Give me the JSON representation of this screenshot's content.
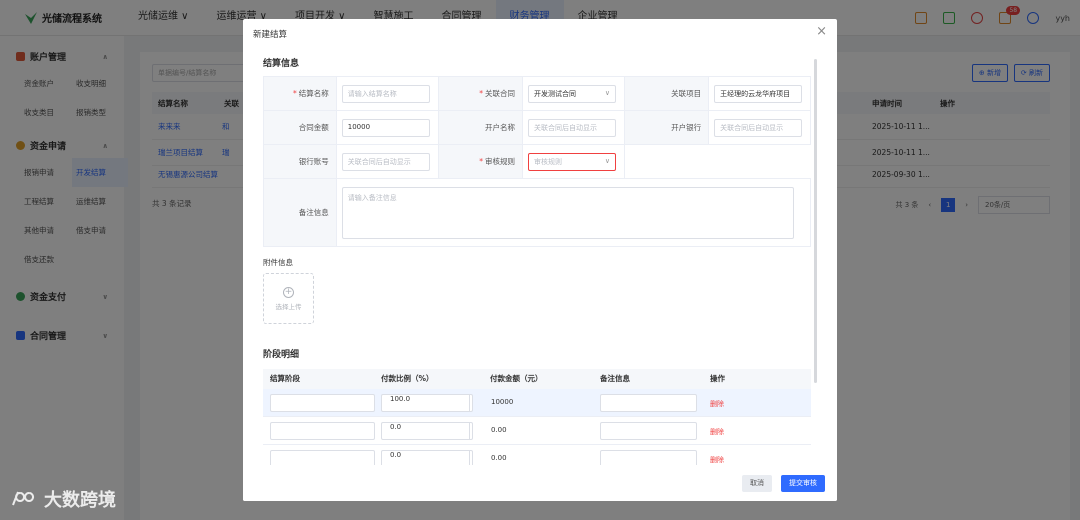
{
  "app": {
    "name": "光储流程系统",
    "user": "yyh",
    "notification_count": "58"
  },
  "nav": [
    "光储运维 ∨",
    "运维运营 ∨",
    "项目开发 ∨",
    "智慧施工",
    "合同管理",
    "财务管理",
    "企业管理"
  ],
  "sidebar": {
    "groups": [
      {
        "label": "账户管理",
        "items": [
          "资金账户",
          "收支明细",
          "收支类目",
          "报销类型"
        ]
      },
      {
        "label": "资金申请",
        "items": [
          "报销申请",
          "开发结算",
          "工程结算",
          "运维结算",
          "其他申请",
          "借支申请",
          "借支还款"
        ]
      },
      {
        "label": "资金支付",
        "items": []
      },
      {
        "label": "合同管理",
        "items": []
      }
    ]
  },
  "main": {
    "search_placeholder": "单据编号/结算名称",
    "btn_add": "⊕ 新增",
    "btn_refresh": "⟳ 刷新",
    "columns": [
      "结算名称",
      "关联",
      "申请时间",
      "操作"
    ],
    "rows": [
      {
        "name": "来来来",
        "rel": "和",
        "time": "2025-10-11 1..."
      },
      {
        "name": "瑞兰项目结算",
        "rel": "瑞",
        "time": "2025-10-11 1..."
      },
      {
        "name": "无锡惠源公司结算",
        "rel": "",
        "time": "2025-09-30 1..."
      }
    ],
    "total": "共 3 条记录",
    "pager": {
      "total": "共 3 条",
      "page": "1",
      "size": "20条/页"
    }
  },
  "modal": {
    "title": "新建结算",
    "section_info": "结算信息",
    "fields": {
      "name_label": "结算名称",
      "name_placeholder": "请输入结算名称",
      "contract_label": "关联合同",
      "contract_value": "开发测试合同",
      "project_label": "关联项目",
      "project_value": "王经理的云龙华府项目",
      "amount_label": "合同金额",
      "amount_value": "10000",
      "account_name_label": "开户名称",
      "account_name_placeholder": "关联合同后自动显示",
      "bank_label": "开户银行",
      "bank_placeholder": "关联合同后自动显示",
      "bank_no_label": "银行账号",
      "bank_no_placeholder": "关联合同后自动显示",
      "rule_label": "审核规则",
      "rule_placeholder": "审核规则",
      "remark_label": "备注信息",
      "remark_placeholder": "请输入备注信息"
    },
    "attach_label": "附件信息",
    "upload_label": "选择上传",
    "section_stage": "阶段明细",
    "stage_columns": [
      "结算阶段",
      "付款比例（%）",
      "付款金额（元）",
      "备注信息",
      "操作"
    ],
    "stages": [
      {
        "ratio": "100.0",
        "amount": "10000",
        "action": "删除"
      },
      {
        "ratio": "0.0",
        "amount": "0.00",
        "action": "删除"
      },
      {
        "ratio": "0.0",
        "amount": "0.00",
        "action": "删除"
      }
    ],
    "btn_cancel": "取消",
    "btn_submit": "提交审核"
  },
  "watermark": "大数跨境"
}
